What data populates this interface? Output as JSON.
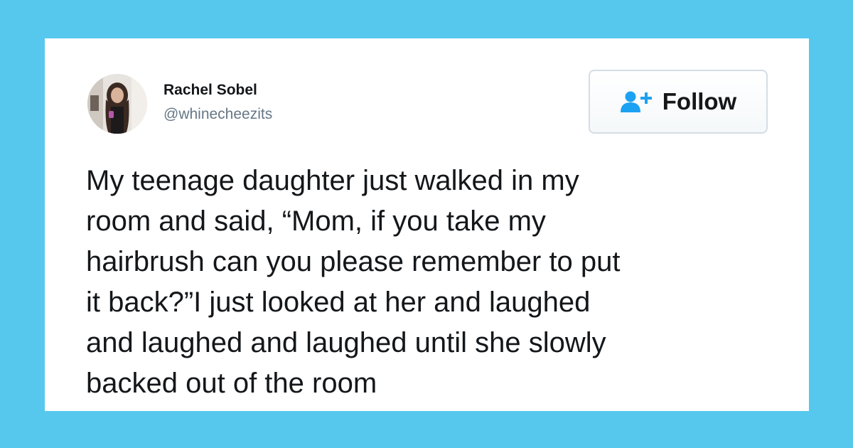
{
  "tweet": {
    "author": {
      "name": "Rachel Sobel",
      "handle": "@whinecheezits"
    },
    "follow_button": {
      "label": "Follow",
      "icon": "add-user-icon"
    },
    "text_lines": [
      "My teenage daughter just walked in my",
      "room and said, “Mom, if you take my",
      "hairbrush can you please remember to put",
      "it back?”I just looked at her and laughed",
      "and laughed and laughed until she slowly",
      "backed out of the room"
    ]
  },
  "colors": {
    "background": "#57c8ed",
    "card": "#ffffff",
    "text": "#14171a",
    "handle": "#657786",
    "accent": "#1da1f2"
  }
}
